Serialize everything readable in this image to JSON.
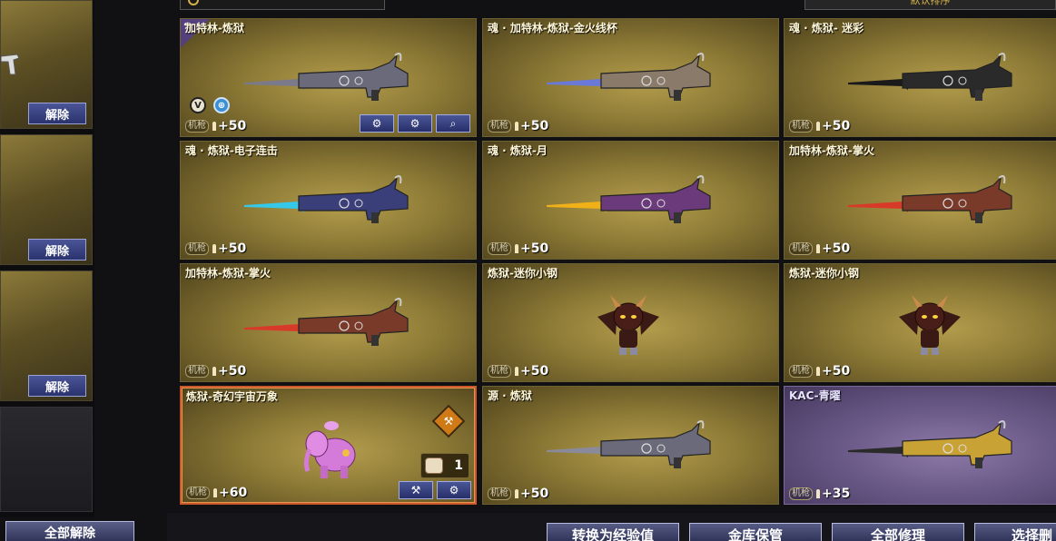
{
  "left_slots": {
    "unequip_label": "解除",
    "unequip_all_label": "全部解除"
  },
  "top": {
    "sort_label": "默认排序"
  },
  "items": [
    {
      "name": "加特林-炼狱",
      "type": "机枪",
      "bonus": "+50",
      "theme": "gold",
      "weapon_color": "#6a6a7a",
      "tip_color": "#7a7a8a"
    },
    {
      "name": "魂 · 加特林-炼狱-金火线杯",
      "type": "机枪",
      "bonus": "+50",
      "theme": "gold",
      "weapon_color": "#8a7a6a",
      "tip_color": "#6a78d8"
    },
    {
      "name": "魂 · 炼狱- 迷彩",
      "type": "机枪",
      "bonus": "+50",
      "theme": "gold",
      "weapon_color": "#2a2a2a",
      "tip_color": "#1a1a1a"
    },
    {
      "name": "魂 · 炼狱-电子连击",
      "type": "机枪",
      "bonus": "+50",
      "theme": "gold",
      "weapon_color": "#3a3f7a",
      "tip_color": "#35c8e8"
    },
    {
      "name": "魂 · 炼狱-月",
      "type": "机枪",
      "bonus": "+50",
      "theme": "gold",
      "weapon_color": "#6a3a7a",
      "tip_color": "#f0b018"
    },
    {
      "name": "加特林-炼狱-掌火",
      "type": "机枪",
      "bonus": "+50",
      "theme": "gold",
      "weapon_color": "#7a3a2a",
      "tip_color": "#d83a2a"
    },
    {
      "name": "加特林-炼狱-掌火",
      "type": "机枪",
      "bonus": "+50",
      "theme": "gold",
      "weapon_color": "#7a3a2a",
      "tip_color": "#d83a2a"
    },
    {
      "name": "炼狱-迷你小钢",
      "type": "机枪",
      "bonus": "+50",
      "theme": "gold",
      "pet": "demon"
    },
    {
      "name": "炼狱-迷你小钢",
      "type": "机枪",
      "bonus": "+50",
      "theme": "gold",
      "pet": "demon"
    },
    {
      "name": "炼狱-奇幻宇宙万象",
      "type": "机枪",
      "bonus": "+60",
      "theme": "gold",
      "pet": "elephant",
      "count": "1"
    },
    {
      "name": "源 · 炼狱",
      "type": "机枪",
      "bonus": "+50",
      "theme": "gold",
      "weapon_color": "#6a6a7a",
      "tip_color": "#8a8a9a"
    },
    {
      "name": "KAC-青曜",
      "type": "机枪",
      "bonus": "+35",
      "theme": "purple",
      "weapon_color": "#c9a236",
      "tip_color": "#2a2a2a"
    }
  ],
  "actions": {
    "convert_label": "转换为经验值",
    "vault_label": "金库保管",
    "repair_all_label": "全部修理",
    "select_label": "选择删"
  },
  "colors": {
    "accent": "#d6b24a",
    "button_blue": "#2a336d",
    "selected_border": "#c9592a"
  }
}
